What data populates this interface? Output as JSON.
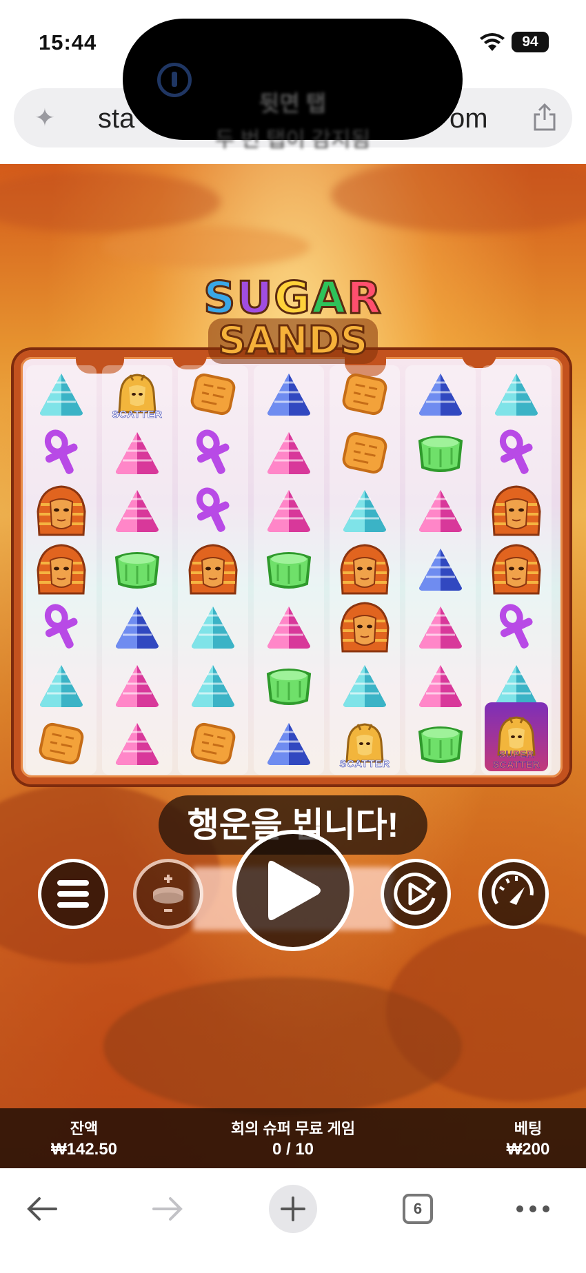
{
  "status": {
    "time": "15:44",
    "battery": "94"
  },
  "notification": {
    "title": "뒷면 탭",
    "subtitle": "두 번 탭이 감지됨"
  },
  "browser": {
    "url_prefix": "sta",
    "url_suffix": "om",
    "tab_count": "6"
  },
  "game": {
    "logo_line1": [
      "S",
      "U",
      "G",
      "A",
      "R"
    ],
    "logo_line1_colors": [
      "#3aa7e8",
      "#a04de0",
      "#ffd23a",
      "#2ec25a",
      "#ff4f6e"
    ],
    "logo_line2": "SANDS",
    "banner": "행운을 빕니다!",
    "reels": [
      [
        "pyramid-teal",
        "ankh-purple",
        "pharaoh",
        "pharaoh",
        "ankh-purple",
        "pyramid-teal",
        "tablet-orange"
      ],
      [
        "scatter",
        "pyramid-pink",
        "pyramid-pink",
        "jelly-green",
        "pyramid-blue",
        "pyramid-pink",
        "pyramid-pink"
      ],
      [
        "tablet-orange",
        "ankh-purple",
        "ankh-purple",
        "pharaoh",
        "pyramid-teal",
        "pyramid-teal",
        "tablet-orange"
      ],
      [
        "pyramid-blue",
        "pyramid-pink",
        "pyramid-pink",
        "jelly-green",
        "pyramid-pink",
        "jelly-green",
        "pyramid-blue"
      ],
      [
        "tablet-orange",
        "tablet-orange",
        "pyramid-teal",
        "pharaoh",
        "pharaoh",
        "pyramid-teal",
        "scatter"
      ],
      [
        "pyramid-blue",
        "jelly-green",
        "pyramid-pink",
        "pyramid-blue",
        "pyramid-pink",
        "pyramid-pink",
        "jelly-green"
      ],
      [
        "pyramid-teal",
        "ankh-purple",
        "pharaoh",
        "pharaoh",
        "ankh-purple",
        "pyramid-teal",
        "super-scatter"
      ]
    ],
    "symbol_labels": {
      "scatter": "SCATTER",
      "super_scatter_line1": "SUPER",
      "super_scatter_line2": "SCATTER"
    },
    "controls": {
      "menu": "menu-icon",
      "bet": "coin-stack-icon",
      "spin": "play-icon",
      "autoplay": "autoplay-icon",
      "turbo": "speedometer-icon"
    },
    "info": {
      "balance_label": "잔액",
      "balance_value": "₩142.50",
      "free_label": "회의 슈퍼 무료 게임",
      "free_value": "0 / 10",
      "bet_label": "베팅",
      "bet_value": "₩200"
    }
  }
}
